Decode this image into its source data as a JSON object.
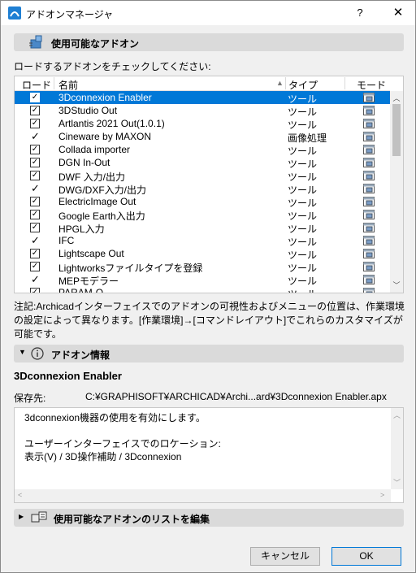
{
  "window": {
    "title": "アドオンマネージャ",
    "help": "?",
    "close": "✕"
  },
  "available_section": {
    "title": "使用可能なアドオン"
  },
  "instructions": "ロードするアドオンをチェックしてください:",
  "table": {
    "headers": {
      "load": "ロード",
      "name": "名前",
      "type": "タイプ",
      "mode": "モード"
    },
    "rows": [
      {
        "check": "box",
        "name": "3Dconnexion Enabler",
        "type": "ツール",
        "selected": true
      },
      {
        "check": "box",
        "name": "3DStudio Out",
        "type": "ツール"
      },
      {
        "check": "box",
        "name": "Artlantis 2021 Out(1.0.1)",
        "type": "ツール"
      },
      {
        "check": "tick",
        "name": "Cineware by MAXON",
        "type": "画像処理"
      },
      {
        "check": "box",
        "name": "Collada importer",
        "type": "ツール"
      },
      {
        "check": "box",
        "name": "DGN In-Out",
        "type": "ツール"
      },
      {
        "check": "box",
        "name": "DWF 入力/出力",
        "type": "ツール"
      },
      {
        "check": "tick",
        "name": "DWG/DXF入力/出力",
        "type": "ツール"
      },
      {
        "check": "box",
        "name": "ElectricImage Out",
        "type": "ツール"
      },
      {
        "check": "box",
        "name": "Google Earth入出力",
        "type": "ツール"
      },
      {
        "check": "box",
        "name": "HPGL入力",
        "type": "ツール"
      },
      {
        "check": "tick",
        "name": "IFC",
        "type": "ツール"
      },
      {
        "check": "box",
        "name": "Lightscape Out",
        "type": "ツール"
      },
      {
        "check": "box",
        "name": "Lightworksファイルタイプを登録",
        "type": "ツール"
      },
      {
        "check": "tick",
        "name": "MEPモデラー",
        "type": "ツール"
      },
      {
        "check": "box",
        "name": "PARAM-O",
        "type": "ツール"
      }
    ]
  },
  "note": "注記:Archicadインターフェイスでのアドオンの可視性およびメニューの位置は、作業環境の設定によって異なります。[作業環境]→[コマンドレイアウト]でこれらのカスタマイズが可能です。",
  "info_section": {
    "title": "アドオン情報"
  },
  "selected_addon": {
    "name": "3Dconnexion Enabler",
    "path_label": "保存先:",
    "path": "C:¥GRAPHISOFT¥ARCHICAD¥Archi...ard¥3Dconnexion Enabler.apx",
    "description_lines": [
      "3dconnexion機器の使用を有効にします。",
      "",
      "ユーザーインターフェイスでのロケーション:",
      "表示(V) / 3D操作補助 / 3Dconnexion"
    ]
  },
  "edit_section": {
    "title": "使用可能なアドオンのリストを編集"
  },
  "buttons": {
    "cancel": "キャンセル",
    "ok": "OK"
  },
  "colors": {
    "selection": "#0078d7",
    "section_bar": "#dadada",
    "background": "#f0f0f0"
  }
}
